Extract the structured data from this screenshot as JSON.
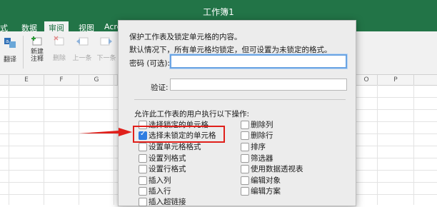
{
  "window": {
    "title": "工作簿1"
  },
  "tabs": [
    {
      "label": "式"
    },
    {
      "label": "数据"
    },
    {
      "label": "审阅"
    },
    {
      "label": "视图"
    },
    {
      "label": "Acro"
    }
  ],
  "ribbon": {
    "translate_label": "翻译",
    "new_comment_label": "新建\n注释",
    "delete_label": "删除",
    "previous_label": "上一条",
    "next_label": "下一条"
  },
  "columns": [
    "E",
    "F",
    "G",
    "O",
    "P"
  ],
  "dialog": {
    "heading": "保护工作表及锁定单元格的内容。",
    "description": "默认情况下，所有单元格均锁定，但可设置为未锁定的格式。",
    "password_label": "密码 (可选):",
    "password_value": "",
    "verify_label": "验证:",
    "verify_value": "",
    "allow_heading": "允许此工作表的用户执行以下操作:",
    "options_left": [
      {
        "label": "选择锁定的单元格",
        "checked": false
      },
      {
        "label": "选择未锁定的单元格",
        "checked": true
      },
      {
        "label": "设置单元格格式",
        "checked": false
      },
      {
        "label": "设置列格式",
        "checked": false
      },
      {
        "label": "设置行格式",
        "checked": false
      },
      {
        "label": "插入列",
        "checked": false
      },
      {
        "label": "插入行",
        "checked": false
      },
      {
        "label": "插入超链接",
        "checked": false
      }
    ],
    "options_right": [
      {
        "label": "删除列",
        "checked": false
      },
      {
        "label": "删除行",
        "checked": false
      },
      {
        "label": "排序",
        "checked": false
      },
      {
        "label": "筛选器",
        "checked": false
      },
      {
        "label": "使用数据透视表",
        "checked": false
      },
      {
        "label": "编辑对象",
        "checked": false
      },
      {
        "label": "编辑方案",
        "checked": false
      }
    ]
  },
  "colors": {
    "excel_green": "#227447",
    "annotation_red": "#e0201b",
    "checkbox_blue": "#2f7de1"
  }
}
